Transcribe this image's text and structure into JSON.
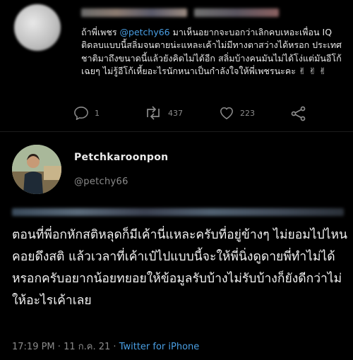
{
  "reply": {
    "text_before_mention": "ถ้าพี่เพชร ",
    "mention": "@petchy66",
    "text_after_mention": " มาเห็นอยากจะบอกว่าเลิกคบเหอะเพื่อน IQ ติดลบแบบนี้สลิ่มจนตายน่ะแหละเค้าไม่มีทางตาสว่างได้หรอก ประเทศชาติมาถึงขนาดนี้แล้วยังคิดไม่ได้อีก สลิ่มบ้างคนมันไม่ได้โง่แต่มันอีโก้เฉยๆ ไม่รู้อีโก้เหี้ยอะไรนักหนาเป็นกำลังใจให้พี่เพชรนะคะ ✌ ✌ ✌",
    "actions": {
      "reply_count": "1",
      "retweet_count": "437",
      "like_count": "223"
    }
  },
  "tweet": {
    "display_name": "Petchkaroonpon",
    "handle": "@petchy66",
    "text": "ตอนที่พี่อกหักสติหลุดก็มีเค้านี่แหละครับที่อยู่ข้างๆ ไม่ยอมไปไหนคอยดึงสติ แล้วเวลาที่เค้าเป๋ไปแบบนี้จะให้พี่นิ่งดูดายพี่ทำไม่ได้หรอกครับอยากน้อยทยอยให้ข้อมูลรับบ้างไม่รับบ้างก็ยังดีกว่าไม่ให้อะไรเค้าเลย",
    "time": "17:19 PM",
    "date": "11 ก.ค. 21",
    "separator": "·",
    "source": "Twitter for iPhone"
  },
  "colors": {
    "background": "#000000",
    "accent": "#4a9fe4",
    "muted": "#8b8b8b"
  }
}
